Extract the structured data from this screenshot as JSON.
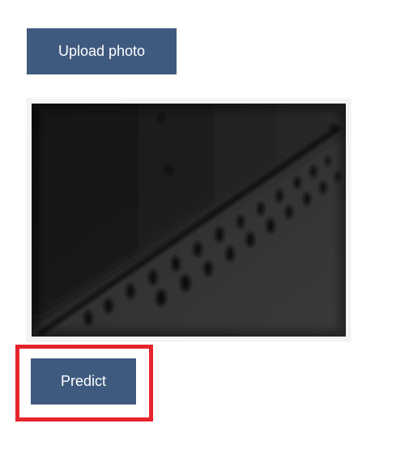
{
  "upload": {
    "label": "Upload photo"
  },
  "photo": {
    "description": "uploaded-photo"
  },
  "predict": {
    "label": "Predict"
  },
  "colors": {
    "button_bg": "#3f5a7f",
    "button_text": "#ffffff",
    "highlight_border": "#e6242d",
    "frame_bg": "#f3f3f3"
  }
}
